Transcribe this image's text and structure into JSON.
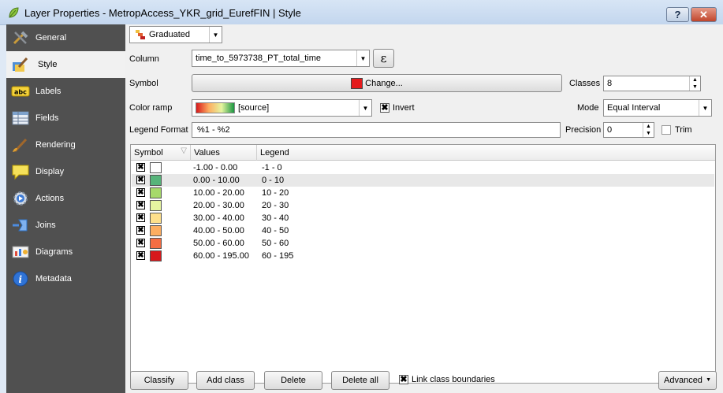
{
  "window": {
    "title": "Layer Properties - MetropAccess_YKR_grid_EurefFIN | Style",
    "help": "?",
    "close": "✕"
  },
  "sidebar": {
    "items": [
      {
        "label": "General",
        "icon": "general-tools-icon"
      },
      {
        "label": "Style",
        "icon": "style-brush-icon"
      },
      {
        "label": "Labels",
        "icon": "labels-abc-icon"
      },
      {
        "label": "Fields",
        "icon": "fields-table-icon"
      },
      {
        "label": "Rendering",
        "icon": "rendering-brush-icon"
      },
      {
        "label": "Display",
        "icon": "display-speech-icon"
      },
      {
        "label": "Actions",
        "icon": "actions-gear-icon"
      },
      {
        "label": "Joins",
        "icon": "joins-icon"
      },
      {
        "label": "Diagrams",
        "icon": "diagrams-icon"
      },
      {
        "label": "Metadata",
        "icon": "metadata-info-icon"
      }
    ],
    "active": "Style"
  },
  "renderer": {
    "type": "Graduated"
  },
  "column": {
    "label": "Column",
    "value": "time_to_5973738_PT_total_time",
    "expr_symbol": "ε"
  },
  "symbol": {
    "label": "Symbol",
    "button": "Change...",
    "color": "#e41a1c"
  },
  "classes": {
    "label": "Classes",
    "value": "8"
  },
  "color_ramp": {
    "label": "Color ramp",
    "value": "[source]",
    "invert_label": "Invert",
    "invert_checked": true
  },
  "mode": {
    "label": "Mode",
    "value": "Equal Interval"
  },
  "legend_format": {
    "label": "Legend Format",
    "value": "%1 - %2"
  },
  "precision": {
    "label": "Precision",
    "value": "0",
    "trim_label": "Trim",
    "trim_checked": false
  },
  "table": {
    "headers": [
      "Symbol",
      "Values",
      "Legend"
    ],
    "rows": [
      {
        "values": "-1.00 - 0.00",
        "legend": "-1 - 0",
        "color": "#ffffff"
      },
      {
        "values": "0.00 - 10.00",
        "legend": "0 - 10",
        "color": "#56b47a"
      },
      {
        "values": "10.00 - 20.00",
        "legend": "10 - 20",
        "color": "#a6d96a"
      },
      {
        "values": "20.00 - 30.00",
        "legend": "20 - 30",
        "color": "#e6f5a0"
      },
      {
        "values": "30.00 - 40.00",
        "legend": "30 - 40",
        "color": "#fee08b"
      },
      {
        "values": "40.00 - 50.00",
        "legend": "40 - 50",
        "color": "#fdae61"
      },
      {
        "values": "50.00 - 60.00",
        "legend": "50 - 60",
        "color": "#f46d43"
      },
      {
        "values": "60.00 - 195.00",
        "legend": "60 - 195",
        "color": "#d7191c"
      }
    ]
  },
  "bottom": {
    "classify": "Classify",
    "add_class": "Add class",
    "delete": "Delete",
    "delete_all": "Delete all",
    "link_label": "Link class boundaries",
    "link_checked": true,
    "advanced": "Advanced"
  }
}
